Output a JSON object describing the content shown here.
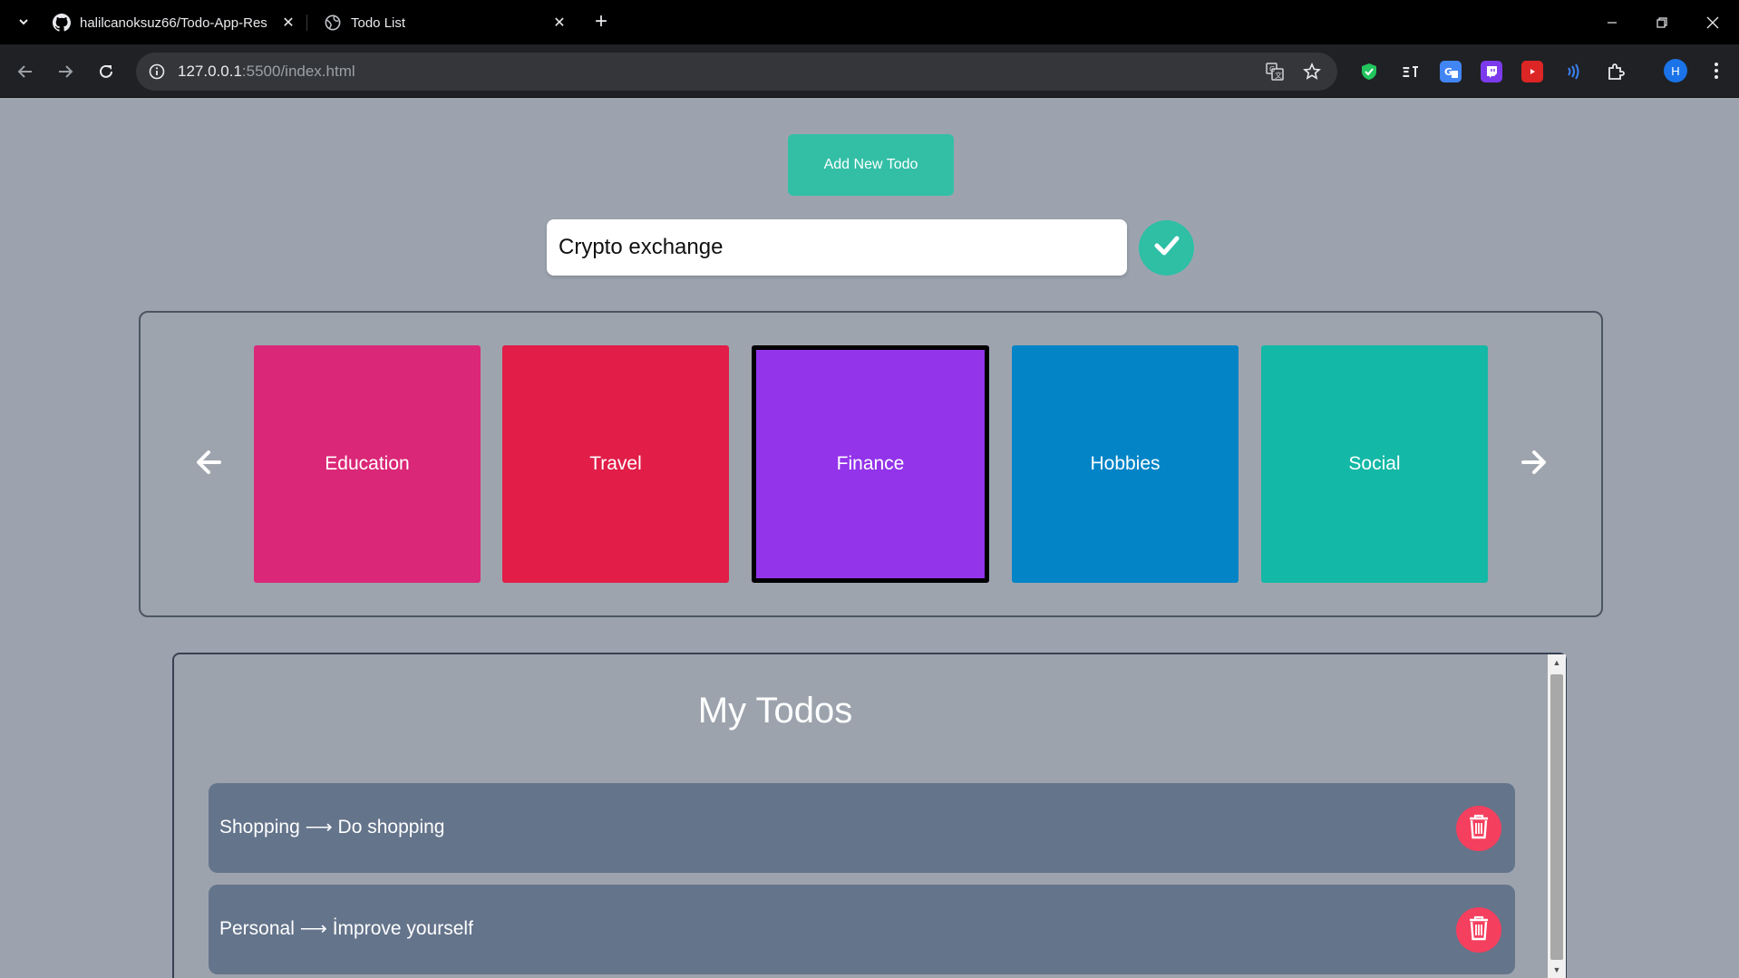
{
  "browser": {
    "tabs": [
      {
        "title": "halilcanoksuz66/Todo-App-Res",
        "favicon": "github-icon"
      },
      {
        "title": "Todo List",
        "favicon": "globe-icon"
      }
    ],
    "address": {
      "host": "127.0.0.1",
      "rest": ":5500/index.html"
    },
    "profile_initial": "H"
  },
  "page": {
    "add_button_label": "Add New Todo",
    "input_value": "Crypto exchange",
    "categories": [
      {
        "label": "Education",
        "color": "#db2777"
      },
      {
        "label": "Travel",
        "color": "#e11d48"
      },
      {
        "label": "Finance",
        "color": "#9333ea",
        "selected": true
      },
      {
        "label": "Hobbies",
        "color": "#0284c7"
      },
      {
        "label": "Social",
        "color": "#14b8a6"
      }
    ],
    "todos_title": "My Todos",
    "todos": [
      {
        "category": "Shopping",
        "arrow": "⟶",
        "text": "Do shopping"
      },
      {
        "category": "Personal",
        "arrow": "⟶",
        "text": "İmprove yourself"
      }
    ],
    "colors": {
      "background": "#9ca3af",
      "accent": "#33bfa6",
      "todo_row": "#64748b",
      "delete": "#f43f5e"
    }
  }
}
